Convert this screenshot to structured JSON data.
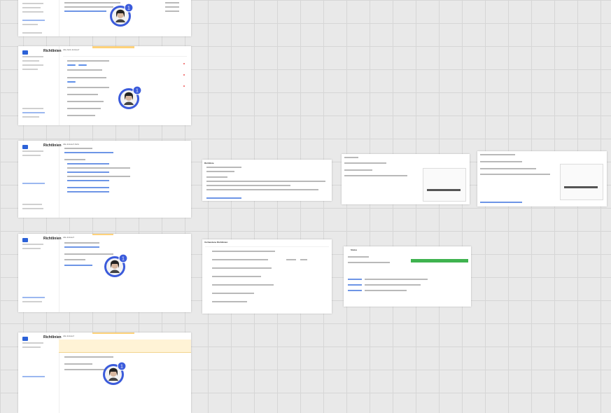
{
  "canvas": {
    "background": "#e9e9e9",
    "grid_color": "#d6d6d6"
  },
  "colors": {
    "accent": "#2c62d8",
    "notification": "#3b5bdb",
    "highlight": "#ffd27a",
    "success": "#3fb34f"
  },
  "boards": {
    "b2": {
      "title": "Richtlinien",
      "tabs": "Alle   Aktiv   Entwurf"
    },
    "b3": {
      "title": "Richtlinien",
      "tabs": "Alle   Entwurf   Aktiv"
    },
    "b4": {
      "title": "Richtlinien",
      "tabs": "Alle   Entwurf"
    },
    "b5": {
      "title": "Richtlinien",
      "tabs": "Alle   Entwurf"
    },
    "b6": {
      "title": "Richtlinie",
      "tabs": ""
    },
    "b7": {
      "title": "Vorhandene Richtlinien",
      "tabs": ""
    },
    "b8": {
      "title": "Status",
      "tabs": ""
    }
  },
  "notification": {
    "count": "1",
    "icon": "user-avatar-icon"
  }
}
